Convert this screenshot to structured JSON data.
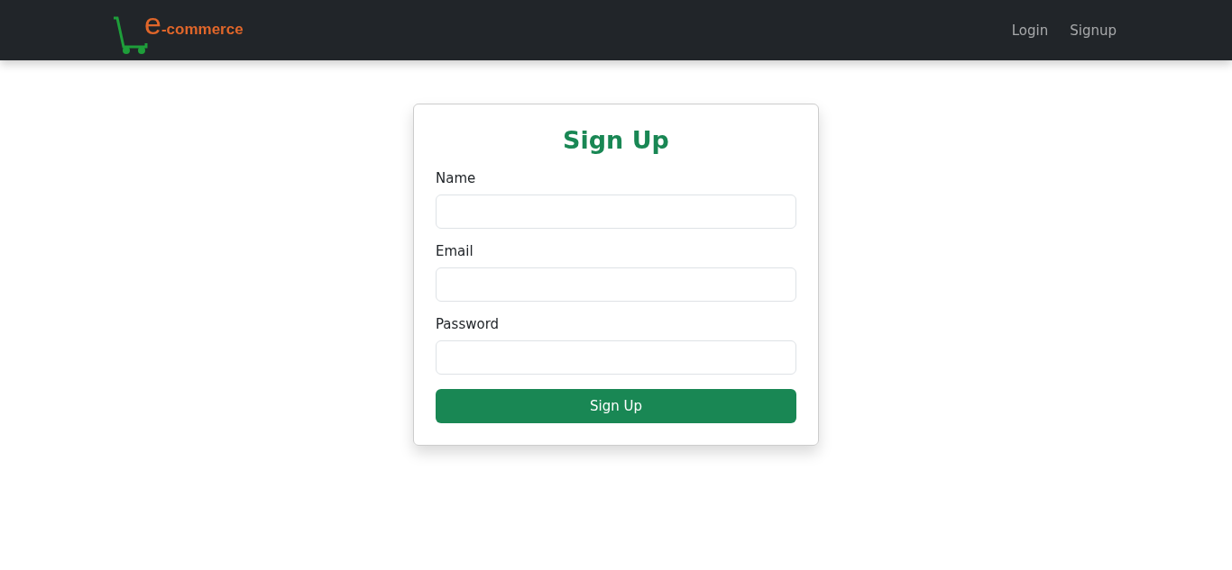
{
  "navbar": {
    "logo": {
      "initial": "e",
      "rest": "-commerce"
    },
    "links": [
      {
        "label": "Login",
        "selected": false
      },
      {
        "label": "Signup",
        "selected": false
      }
    ]
  },
  "form": {
    "title": "Sign Up",
    "fields": [
      {
        "label": "Name"
      },
      {
        "label": "Email"
      },
      {
        "label": "Password"
      }
    ],
    "submit": "Sign Up"
  }
}
